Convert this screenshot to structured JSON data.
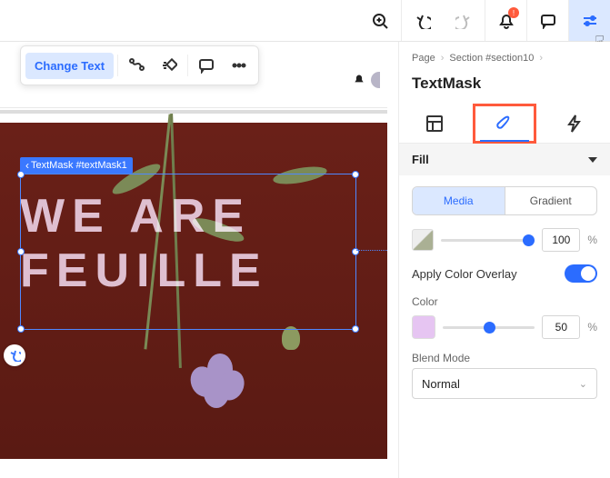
{
  "topbar": {
    "alert_count": "!"
  },
  "canvas": {
    "floating_toolbar": {
      "change_text": "Change Text"
    },
    "selection_label": "TextMask #textMask1",
    "masked_text": "WE ARE\nFEUILLE"
  },
  "panel": {
    "breadcrumbs": [
      "Page",
      "Section #section10"
    ],
    "title": "TextMask",
    "accordion": {
      "fill": "Fill"
    },
    "fill": {
      "segments": {
        "media": "Media",
        "gradient": "Gradient"
      },
      "opacity_value": "100",
      "opacity_unit": "%",
      "apply_overlay_label": "Apply Color Overlay",
      "color_label": "Color",
      "color_value": "50",
      "color_unit": "%",
      "blend_label": "Blend Mode",
      "blend_value": "Normal"
    }
  }
}
